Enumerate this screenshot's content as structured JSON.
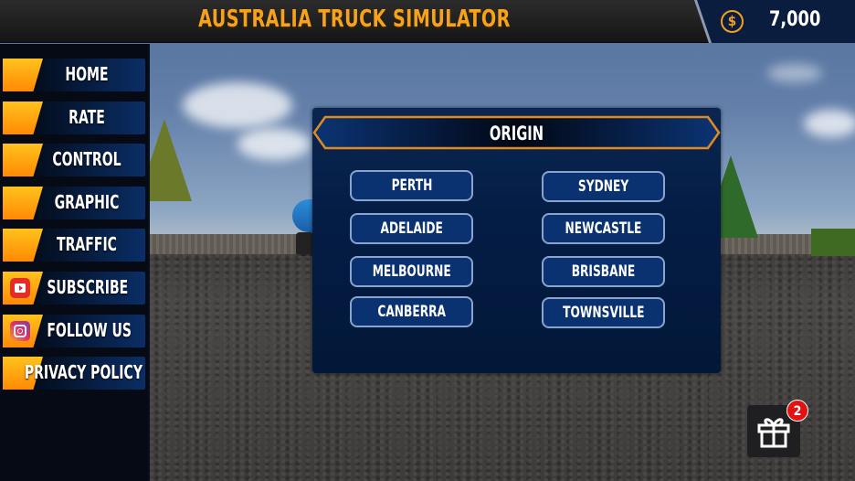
{
  "header": {
    "title": "AUSTRALIA TRUCK SIMULATOR",
    "currency_icon": "dollar-coin-icon",
    "coins": "7,000"
  },
  "sidebar": {
    "items": [
      {
        "label": "HOME",
        "icon": null
      },
      {
        "label": "RATE",
        "icon": null
      },
      {
        "label": "CONTROL",
        "icon": null
      },
      {
        "label": "GRAPHIC",
        "icon": null
      },
      {
        "label": "TRAFFIC",
        "icon": null
      },
      {
        "label": "SUBSCRIBE",
        "icon": "youtube-icon"
      },
      {
        "label": "FOLLOW US",
        "icon": "instagram-icon"
      },
      {
        "label": "PRIVACY POLICY",
        "icon": null
      }
    ]
  },
  "dialog": {
    "title": "ORIGIN",
    "cities": {
      "left": [
        "PERTH",
        "ADELAIDE",
        "MELBOURNE",
        "CANBERRA"
      ],
      "right": [
        "SYDNEY",
        "NEWCASTLE",
        "BRISBANE",
        "TOWNSVILLE"
      ]
    }
  },
  "gift": {
    "icon": "gift-icon",
    "badge_count": "2"
  },
  "colors": {
    "accent_orange": "#f7a21b",
    "panel_navy": "#031b40",
    "button_blue": "#0a3170",
    "badge_red": "#e31212"
  }
}
